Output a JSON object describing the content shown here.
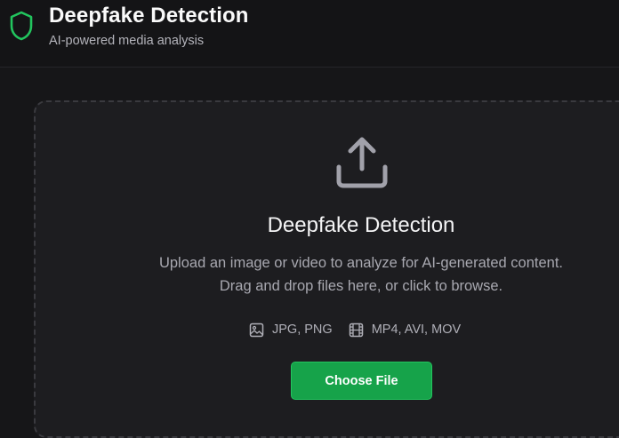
{
  "header": {
    "title": "Deepfake Detection",
    "subtitle": "AI-powered media analysis",
    "logo_icon": "shield-icon",
    "accent_color": "#22c55e"
  },
  "dropzone": {
    "icon": "upload-icon",
    "title": "Deepfake Detection",
    "description": "Upload an image or video to analyze for AI-generated content. Drag and drop files here, or click to browse.",
    "formats": [
      {
        "icon": "image-icon",
        "label": "JPG, PNG"
      },
      {
        "icon": "film-icon",
        "label": "MP4, AVI, MOV"
      }
    ],
    "button_label": "Choose File",
    "button_color": "#16a34a"
  }
}
